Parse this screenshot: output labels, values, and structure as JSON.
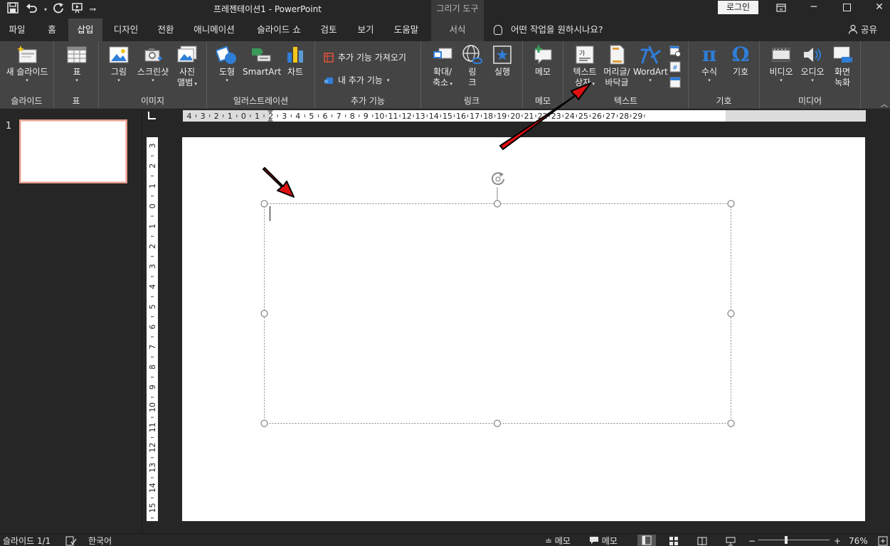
{
  "title_bar": {
    "document_title": "프레젠테이션1  -  PowerPoint",
    "context_tools_label": "그리기 도구",
    "login_label": "로그인",
    "icons": [
      "save-icon",
      "undo-icon",
      "redo-icon",
      "start-from-beginning-icon",
      "customize-qat-icon",
      "ribbon-display-icon",
      "minimize-icon",
      "maximize-icon",
      "close-icon"
    ]
  },
  "tabs": {
    "items": [
      "파일",
      "홈",
      "삽입",
      "디자인",
      "전환",
      "애니메이션",
      "슬라이드 쇼",
      "검토",
      "보기",
      "도움말",
      "서식"
    ],
    "active": "삽입",
    "tell_me": "어떤 작업을 원하시나요?",
    "share": "공유"
  },
  "ribbon": {
    "new_slide": "새 슬라이드",
    "table": "표",
    "picture": "그림",
    "screenshot": "스크린샷",
    "album_line1": "사진",
    "album_line2": "앨범",
    "shapes": "도형",
    "smartart": "SmartArt",
    "chart": "차트",
    "get_addins": "추가 기능 가져오기",
    "my_addins": "내 추가 기능",
    "zoom_line1": "확대/",
    "zoom_line2": "축소",
    "link_line1": "링",
    "link_line2": "크",
    "action": "실행",
    "comment": "메모",
    "textbox_line1": "텍스트",
    "textbox_line2": "상자",
    "header_footer_line1": "머리글/",
    "header_footer_line2": "바닥글",
    "wordart": "WordArt",
    "equation": "수식",
    "symbol": "기호",
    "video": "비디오",
    "audio": "오디오",
    "screen_rec_line1": "화면",
    "screen_rec_line2": "녹화",
    "groups": {
      "slides": "슬라이드",
      "tables": "표",
      "images": "이미지",
      "illustrations": "일러스트레이션",
      "addins": "추가 기능",
      "links": "링크",
      "comments": "메모",
      "text": "텍스트",
      "symbols": "기호",
      "media": "미디어"
    }
  },
  "thumbnails": {
    "slide_number": "1"
  },
  "rulers": {
    "horizontal_ticks": [
      "4",
      "3",
      "2",
      "1",
      "0",
      "1",
      "2",
      "3",
      "4",
      "5",
      "6",
      "7",
      "8",
      "9",
      "10",
      "11",
      "12",
      "13",
      "14",
      "15",
      "16",
      "17",
      "18",
      "19",
      "20",
      "21",
      "22",
      "23",
      "24",
      "25",
      "26",
      "27",
      "28",
      "29"
    ],
    "vertical_ticks": [
      "3",
      "2",
      "1",
      "0",
      "1",
      "2",
      "3",
      "4",
      "5",
      "6",
      "7",
      "8",
      "9",
      "10",
      "11",
      "12",
      "13",
      "14",
      "15"
    ]
  },
  "status_bar": {
    "slide_info": "슬라이드 1/1",
    "language": "한국어",
    "notes": "메모",
    "comments": "메모",
    "zoom_level": "76%",
    "zoom_minus": "−",
    "zoom_plus": "+",
    "zoom_fraction": 0.76
  },
  "colors": {
    "annotation_arrow": "#e01010",
    "selected_thumb_border": "#e8a08e",
    "ribbon_bg": "#444444",
    "window_bg": "#262626"
  }
}
